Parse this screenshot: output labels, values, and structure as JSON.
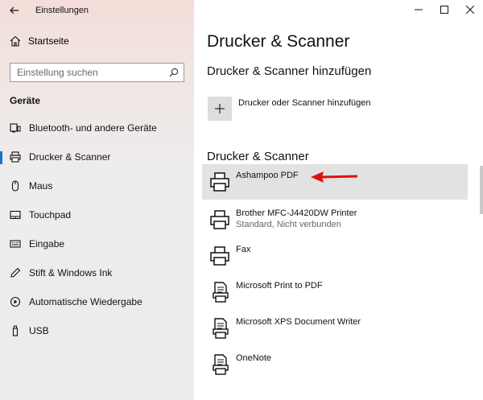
{
  "window": {
    "title": "Einstellungen",
    "controls": {
      "minimize": "–",
      "maximize": "☐",
      "close": "✕"
    }
  },
  "sidebar": {
    "home_label": "Startseite",
    "search_placeholder": "Einstellung suchen",
    "section_label": "Geräte",
    "items": [
      {
        "label": "Bluetooth- und andere Geräte",
        "icon": "bluetooth-devices-icon"
      },
      {
        "label": "Drucker & Scanner",
        "icon": "printer-icon",
        "active": true
      },
      {
        "label": "Maus",
        "icon": "mouse-icon"
      },
      {
        "label": "Touchpad",
        "icon": "touchpad-icon"
      },
      {
        "label": "Eingabe",
        "icon": "keyboard-icon"
      },
      {
        "label": "Stift & Windows Ink",
        "icon": "pen-icon"
      },
      {
        "label": "Automatische Wiedergabe",
        "icon": "autoplay-icon"
      },
      {
        "label": "USB",
        "icon": "usb-icon"
      }
    ]
  },
  "main": {
    "title": "Drucker & Scanner",
    "add_section_title": "Drucker & Scanner hinzufügen",
    "add_label": "Drucker oder Scanner hinzufügen",
    "list_title": "Drucker & Scanner",
    "printers": [
      {
        "name": "Ashampoo PDF",
        "status": "",
        "icon": "printer-icon",
        "selected": true
      },
      {
        "name": "Brother MFC-J4420DW Printer",
        "status": "Standard, Nicht verbunden",
        "icon": "printer-icon"
      },
      {
        "name": "Fax",
        "status": "",
        "icon": "printer-icon"
      },
      {
        "name": "Microsoft Print to PDF",
        "status": "",
        "icon": "document-printer-icon"
      },
      {
        "name": "Microsoft XPS Document Writer",
        "status": "",
        "icon": "document-printer-icon"
      },
      {
        "name": "OneNote",
        "status": "",
        "icon": "document-printer-icon"
      }
    ]
  },
  "colors": {
    "accent": "#1a73c9",
    "annotation_arrow": "#e01010",
    "selected_row": "#e2e2e2"
  }
}
